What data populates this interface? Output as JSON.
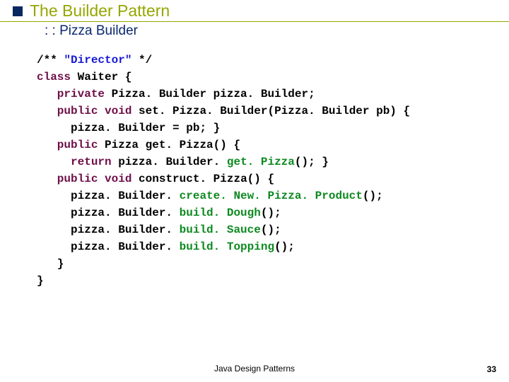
{
  "header": {
    "title": "The Builder Pattern",
    "subtitle": ": : Pizza Builder"
  },
  "code": {
    "l1a": "/** ",
    "l1b": "\"Director\"",
    "l1c": " */",
    "l2a": "class",
    "l2b": " Waiter {",
    "l3a": "   private",
    "l3b": " Pizza. Builder pizza. Builder;",
    "l4a": "   public",
    "l4b": " ",
    "l4c": "void",
    "l4d": " set. Pizza. Builder(Pizza. Builder pb) {",
    "l5": "     pizza. Builder = pb; }",
    "l6a": "   public",
    "l6b": " Pizza get. Pizza() {",
    "l7a": "     return",
    "l7b": " pizza. Builder. ",
    "l7c": "get. Pizza",
    "l7d": "(); }",
    "l8a": "   public",
    "l8b": " ",
    "l8c": "void",
    "l8d": " construct. Pizza() {",
    "l9a": "     pizza. Builder. ",
    "l9b": "create. New. Pizza. Product",
    "l9c": "();",
    "l10a": "     pizza. Builder. ",
    "l10b": "build. Dough",
    "l10c": "();",
    "l11a": "     pizza. Builder. ",
    "l11b": "build. Sauce",
    "l11c": "();",
    "l12a": "     pizza. Builder. ",
    "l12b": "build. Topping",
    "l12c": "();",
    "l13": "   }",
    "l14": "}"
  },
  "footer": {
    "center": "Java Design Patterns",
    "page": "33"
  }
}
